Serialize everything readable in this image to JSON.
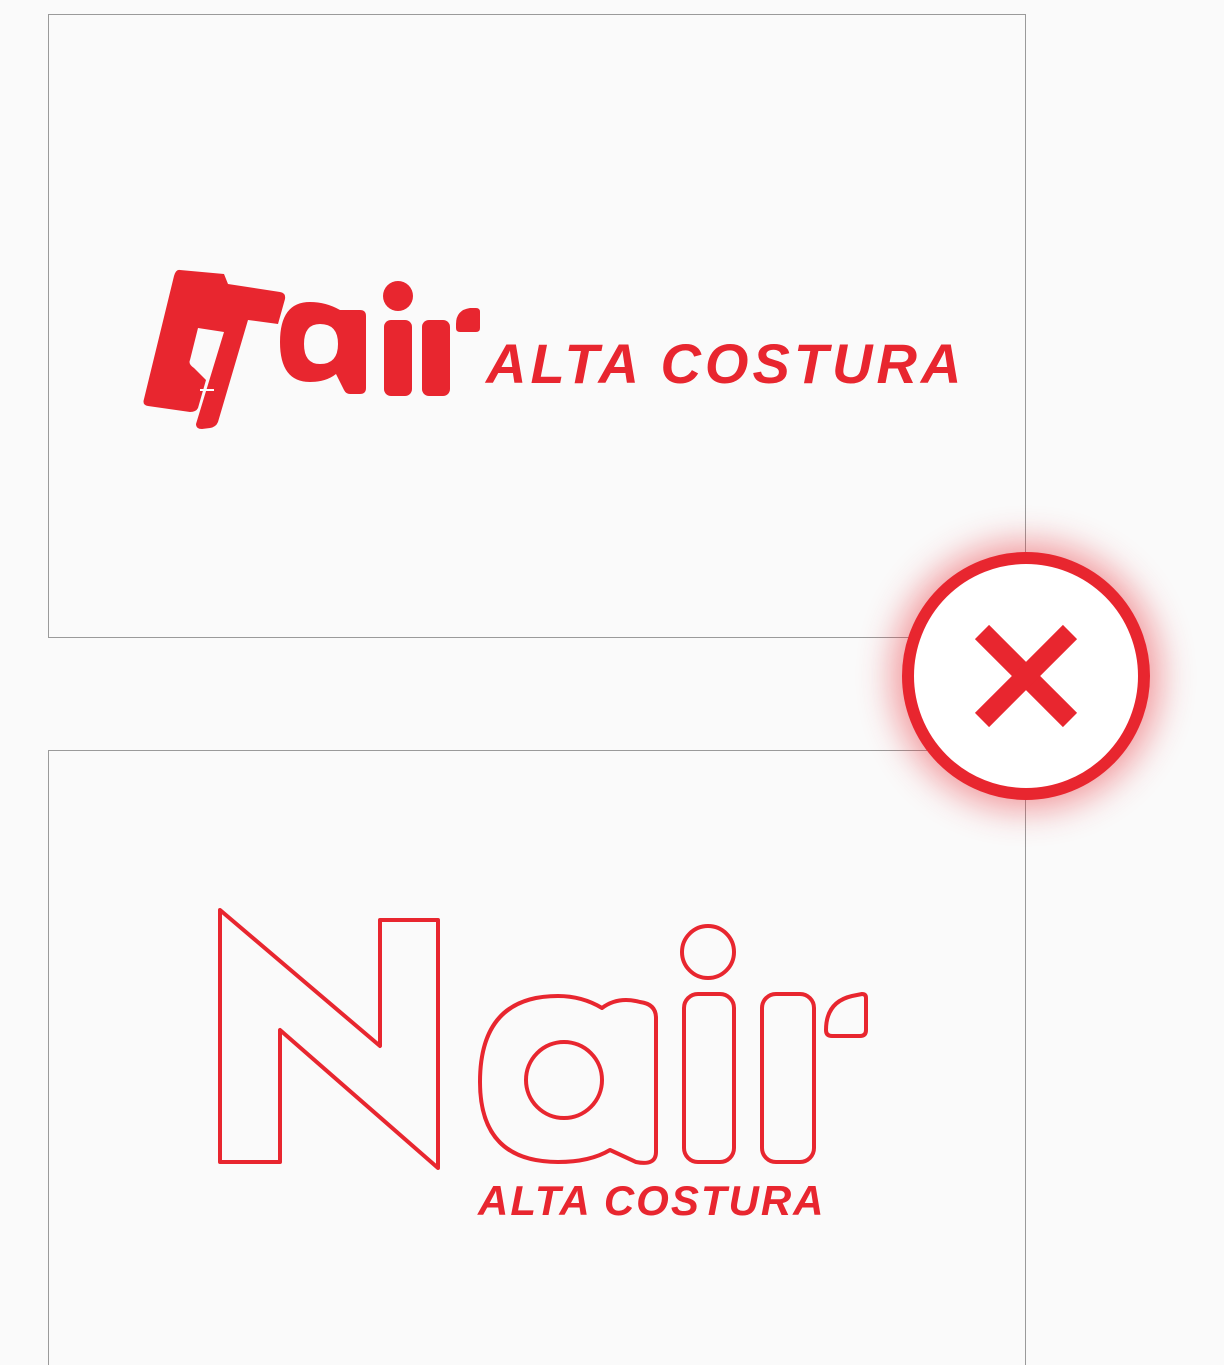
{
  "brand": {
    "wordmark": "nair",
    "color": "#e8262f"
  },
  "examples": [
    {
      "style": "filled",
      "tagline": "ALTA COSTURA"
    },
    {
      "style": "outline",
      "tagline": "ALTA COSTURA"
    }
  ],
  "badge": {
    "icon": "close-icon",
    "meaning": "incorrect usage"
  }
}
